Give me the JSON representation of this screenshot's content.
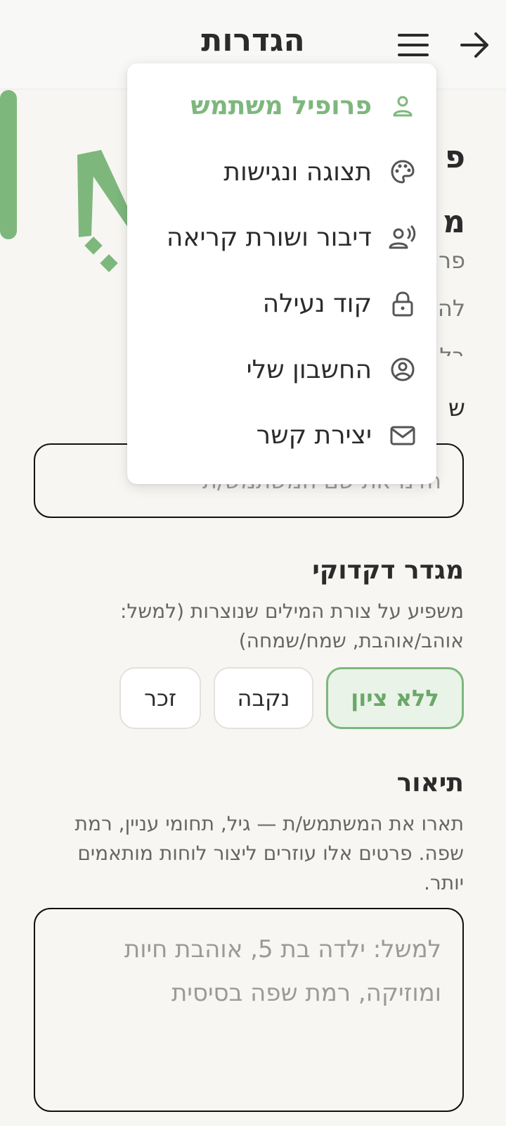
{
  "header": {
    "title": "הגדרות"
  },
  "profile": {
    "title_peek_line1": "פ",
    "title_peek_line2": "מ",
    "desc_peek_line1": "פר",
    "desc_peek_line2": "לה",
    "desc_peek_line3": "בל",
    "name_label_peek": "ש",
    "name_placeholder": "הזינו את שם המשתמש/ת"
  },
  "gender": {
    "title": "מגדר דקדוקי",
    "description": "משפיע על צורת המילים שנוצרות (למשל: אוהב/אוהבת, שמח/שמחה)",
    "options": [
      "ללא ציון",
      "נקבה",
      "זכר"
    ],
    "selected": "ללא ציון"
  },
  "description_section": {
    "title": "תיאור",
    "description": "תארו את המשתמש/ת — גיל, תחומי עניין, רמת שפה. פרטים אלו עוזרים ליצור לוחות מותאמים יותר.",
    "placeholder": "למשל: ילדה בת 5, אוהבת חיות ומוזיקה, רמת שפה בסיסית"
  },
  "menu": {
    "items": [
      {
        "label": "פרופיל משתמש",
        "icon": "user-icon",
        "active": true
      },
      {
        "label": "תצוגה ונגישות",
        "icon": "palette-icon",
        "active": false
      },
      {
        "label": "דיבור ושורת קריאה",
        "icon": "speech-icon",
        "active": false
      },
      {
        "label": "קוד נעילה",
        "icon": "lock-icon",
        "active": false
      },
      {
        "label": "החשבון שלי",
        "icon": "account-icon",
        "active": false
      },
      {
        "label": "יצירת קשר",
        "icon": "mail-icon",
        "active": false
      }
    ]
  },
  "colors": {
    "accent": "#7db77c",
    "background": "#f7f6f3",
    "text": "#2b2b2b"
  }
}
